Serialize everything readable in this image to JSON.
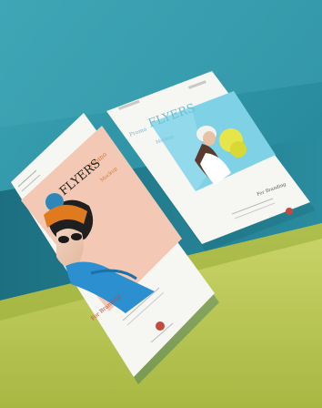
{
  "flyer_front": {
    "word_1": "Promo",
    "word_2": "FLYERS",
    "word_3": "Mockup",
    "footer": "For Branding"
  },
  "flyer_back": {
    "word_1": "Promo",
    "word_2": "FLYERS",
    "word_3": "Mockup",
    "footer": "For Branding"
  },
  "colors": {
    "backdrop_teal": "#2c8da0",
    "floor_lime": "#b9c755",
    "paper": "#f6f6f3",
    "accent_orange": "#d9742b",
    "accent_red": "#c24a3f",
    "sky_blue": "#7fd2e6"
  }
}
